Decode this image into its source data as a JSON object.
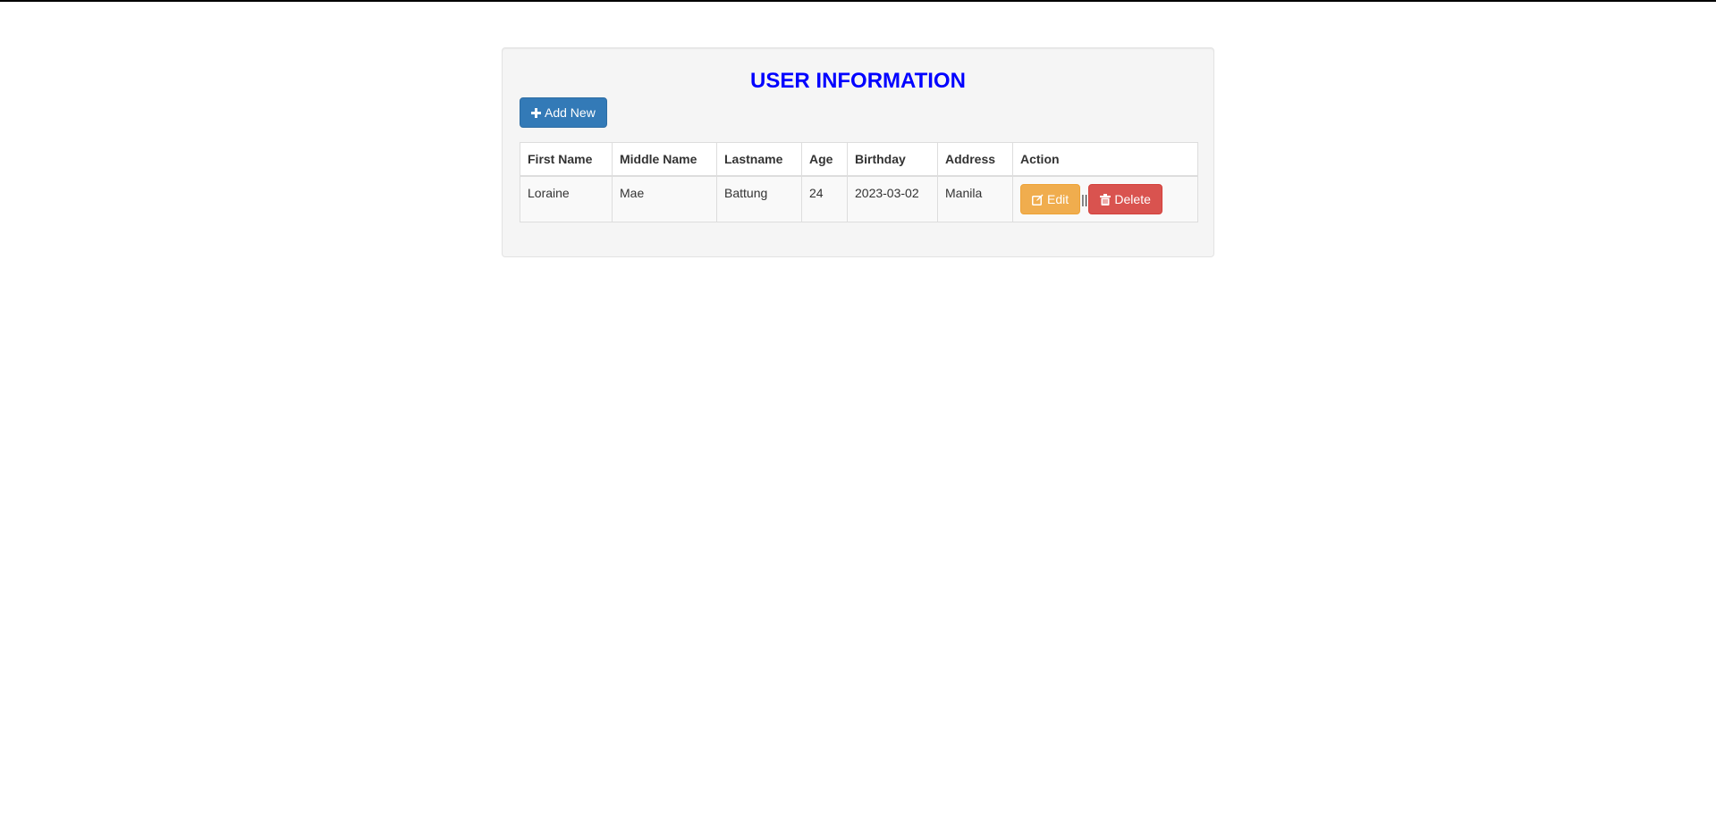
{
  "page": {
    "title": "USER INFORMATION",
    "title_color": "#0000ff"
  },
  "toolbar": {
    "add_new_label": "Add New",
    "add_new_icon": "plus-icon",
    "add_new_color": "#337ab7"
  },
  "table": {
    "headers": [
      "First Name",
      "Middle Name",
      "Lastname",
      "Age",
      "Birthday",
      "Address",
      "Action"
    ],
    "rows": [
      {
        "first_name": "Loraine",
        "middle_name": "Mae",
        "lastname": "Battung",
        "age": "24",
        "birthday": "2023-03-02",
        "address": "Manila",
        "actions": {
          "edit_label": "Edit",
          "edit_icon": "edit-icon",
          "edit_color": "#f0ad4e",
          "separator": "||",
          "delete_label": "Delete",
          "delete_icon": "trash-icon",
          "delete_color": "#d9534f"
        }
      }
    ]
  }
}
